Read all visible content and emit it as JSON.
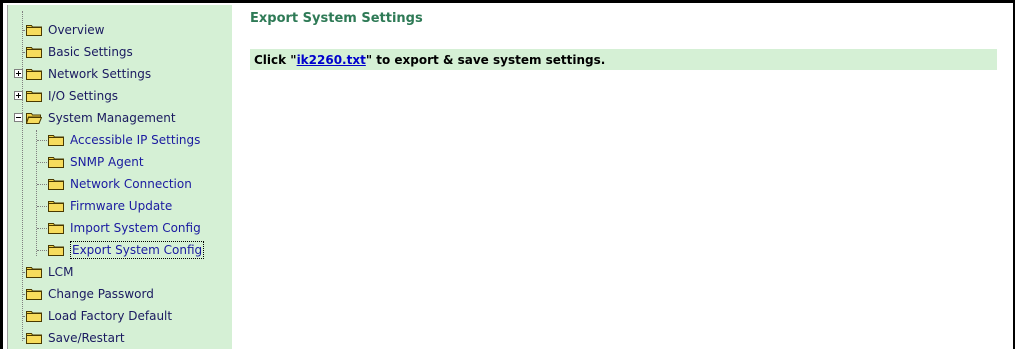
{
  "sidebar": {
    "items": [
      {
        "label": "Overview",
        "level": 0,
        "expander": "none"
      },
      {
        "label": "Basic Settings",
        "level": 0,
        "expander": "none"
      },
      {
        "label": "Network Settings",
        "level": 0,
        "expander": "plus"
      },
      {
        "label": "I/O Settings",
        "level": 0,
        "expander": "plus"
      },
      {
        "label": "System Management",
        "level": 0,
        "expander": "minus",
        "open": true
      },
      {
        "label": "Accessible IP Settings",
        "level": 1
      },
      {
        "label": "SNMP Agent",
        "level": 1
      },
      {
        "label": "Network Connection",
        "level": 1
      },
      {
        "label": "Firmware Update",
        "level": 1
      },
      {
        "label": "Import System Config",
        "level": 1
      },
      {
        "label": "Export System Config",
        "level": 1,
        "current": true
      },
      {
        "label": "LCM",
        "level": 0
      },
      {
        "label": "Change Password",
        "level": 0
      },
      {
        "label": "Load Factory Default",
        "level": 0
      },
      {
        "label": "Save/Restart",
        "level": 0
      }
    ]
  },
  "main": {
    "title": "Export System Settings",
    "export_prefix": "Click \"",
    "export_link": "ik2260.txt",
    "export_suffix": "\" to export & save system settings."
  },
  "colors": {
    "sidebar_bg": "#d5f0d5",
    "title_green": "#2e7a56",
    "link_blue": "#0000cc",
    "folder_yellow": "#f2d24a"
  }
}
